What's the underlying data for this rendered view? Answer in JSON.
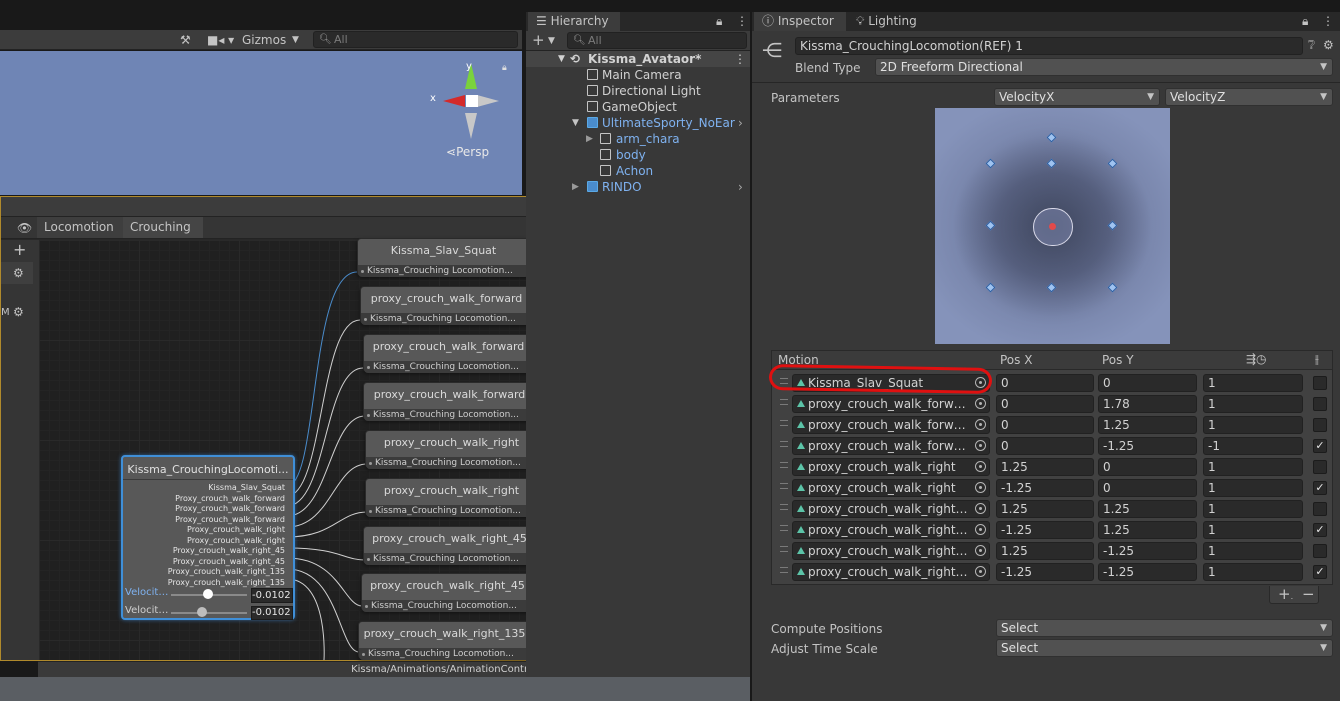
{
  "scene": {
    "gizmos_label": "Gizmos",
    "search_placeholder": "All",
    "gizmo_x": "x",
    "gizmo_y": "y",
    "persp_label": "Persp"
  },
  "hierarchy": {
    "tab_label": "Hierarchy",
    "search_placeholder": "All",
    "items": [
      {
        "label": "Kissma_Avataor*"
      },
      {
        "label": "Main Camera"
      },
      {
        "label": "Directional Light"
      },
      {
        "label": "GameObject"
      },
      {
        "label": "UltimateSporty_NoEar"
      },
      {
        "label": "arm_chara"
      },
      {
        "label": "body"
      },
      {
        "label": "Achon"
      },
      {
        "label": "RINDO"
      }
    ]
  },
  "animator": {
    "breadcrumbs": [
      "Locomotion",
      "Crouching"
    ],
    "side_label": "M",
    "status_path": "Kissma/Animations/AnimationControllers/Kissma_LocomotionLayer.controller",
    "blend_node": {
      "title": "Kissma_CrouchingLocomoti...",
      "children": [
        "Kissma_Slav_Squat",
        "Proxy_crouch_walk_forward",
        "Proxy_crouch_walk_forward",
        "Proxy_crouch_walk_forward",
        "Proxy_crouch_walk_right",
        "Proxy_crouch_walk_right",
        "Proxy_crouch_walk_right_45",
        "Proxy_crouch_walk_right_45",
        "Proxy_crouch_walk_right_135",
        "Proxy_crouch_walk_right_135"
      ],
      "param1_label": "VelocityX",
      "param1_value": "-0.0102",
      "param2_label": "VelocityZ",
      "param2_value": "-0.0102"
    },
    "child_nodes": [
      {
        "title": "Kissma_Slav_Squat",
        "sub": "Kissma_Crouching Locomotion..."
      },
      {
        "title": "proxy_crouch_walk_forward",
        "sub": "Kissma_Crouching Locomotion..."
      },
      {
        "title": "proxy_crouch_walk_forward",
        "sub": "Kissma_Crouching Locomotion..."
      },
      {
        "title": "proxy_crouch_walk_forward",
        "sub": "Kissma_Crouching Locomotion..."
      },
      {
        "title": "proxy_crouch_walk_right",
        "sub": "Kissma_Crouching Locomotion..."
      },
      {
        "title": "proxy_crouch_walk_right",
        "sub": "Kissma_Crouching Locomotion..."
      },
      {
        "title": "proxy_crouch_walk_right_45",
        "sub": "Kissma_Crouching Locomotion..."
      },
      {
        "title": "proxy_crouch_walk_right_45",
        "sub": "Kissma_Crouching Locomotion..."
      },
      {
        "title": "proxy_crouch_walk_right_135",
        "sub": "Kissma_Crouching Locomotion..."
      }
    ]
  },
  "inspector": {
    "tabs": [
      "Inspector",
      "Lighting"
    ],
    "object_name": "Kissma_CrouchingLocomotion(REF) 1",
    "blend_type_label": "Blend Type",
    "blend_type_value": "2D Freeform Directional",
    "parameters_label": "Parameters",
    "param_x": "VelocityX",
    "param_y": "VelocityZ",
    "table_headers": {
      "motion": "Motion",
      "posx": "Pos X",
      "posy": "Pos Y"
    },
    "motions": [
      {
        "name": "Kissma_Slav_Squat",
        "x": "0",
        "y": "0",
        "speed": "1",
        "mirror": false
      },
      {
        "name": "proxy_crouch_walk_forward",
        "x": "0",
        "y": "1.78",
        "speed": "1",
        "mirror": false
      },
      {
        "name": "proxy_crouch_walk_forward",
        "x": "0",
        "y": "1.25",
        "speed": "1",
        "mirror": false
      },
      {
        "name": "proxy_crouch_walk_forward",
        "x": "0",
        "y": "-1.25",
        "speed": "-1",
        "mirror": true
      },
      {
        "name": "proxy_crouch_walk_right",
        "x": "1.25",
        "y": "0",
        "speed": "1",
        "mirror": false
      },
      {
        "name": "proxy_crouch_walk_right",
        "x": "-1.25",
        "y": "0",
        "speed": "1",
        "mirror": true
      },
      {
        "name": "proxy_crouch_walk_right_45",
        "x": "1.25",
        "y": "1.25",
        "speed": "1",
        "mirror": false
      },
      {
        "name": "proxy_crouch_walk_right_45",
        "x": "-1.25",
        "y": "1.25",
        "speed": "1",
        "mirror": true
      },
      {
        "name": "proxy_crouch_walk_right_135",
        "x": "1.25",
        "y": "-1.25",
        "speed": "1",
        "mirror": false
      },
      {
        "name": "proxy_crouch_walk_right_135",
        "x": "-1.25",
        "y": "-1.25",
        "speed": "1",
        "mirror": true
      }
    ],
    "compute_positions_label": "Compute Positions",
    "compute_positions_value": "Select",
    "adjust_time_scale_label": "Adjust Time Scale",
    "adjust_time_scale_value": "Select",
    "colors": {
      "highlight": "#e01010",
      "accent": "#7fb2f0"
    }
  }
}
